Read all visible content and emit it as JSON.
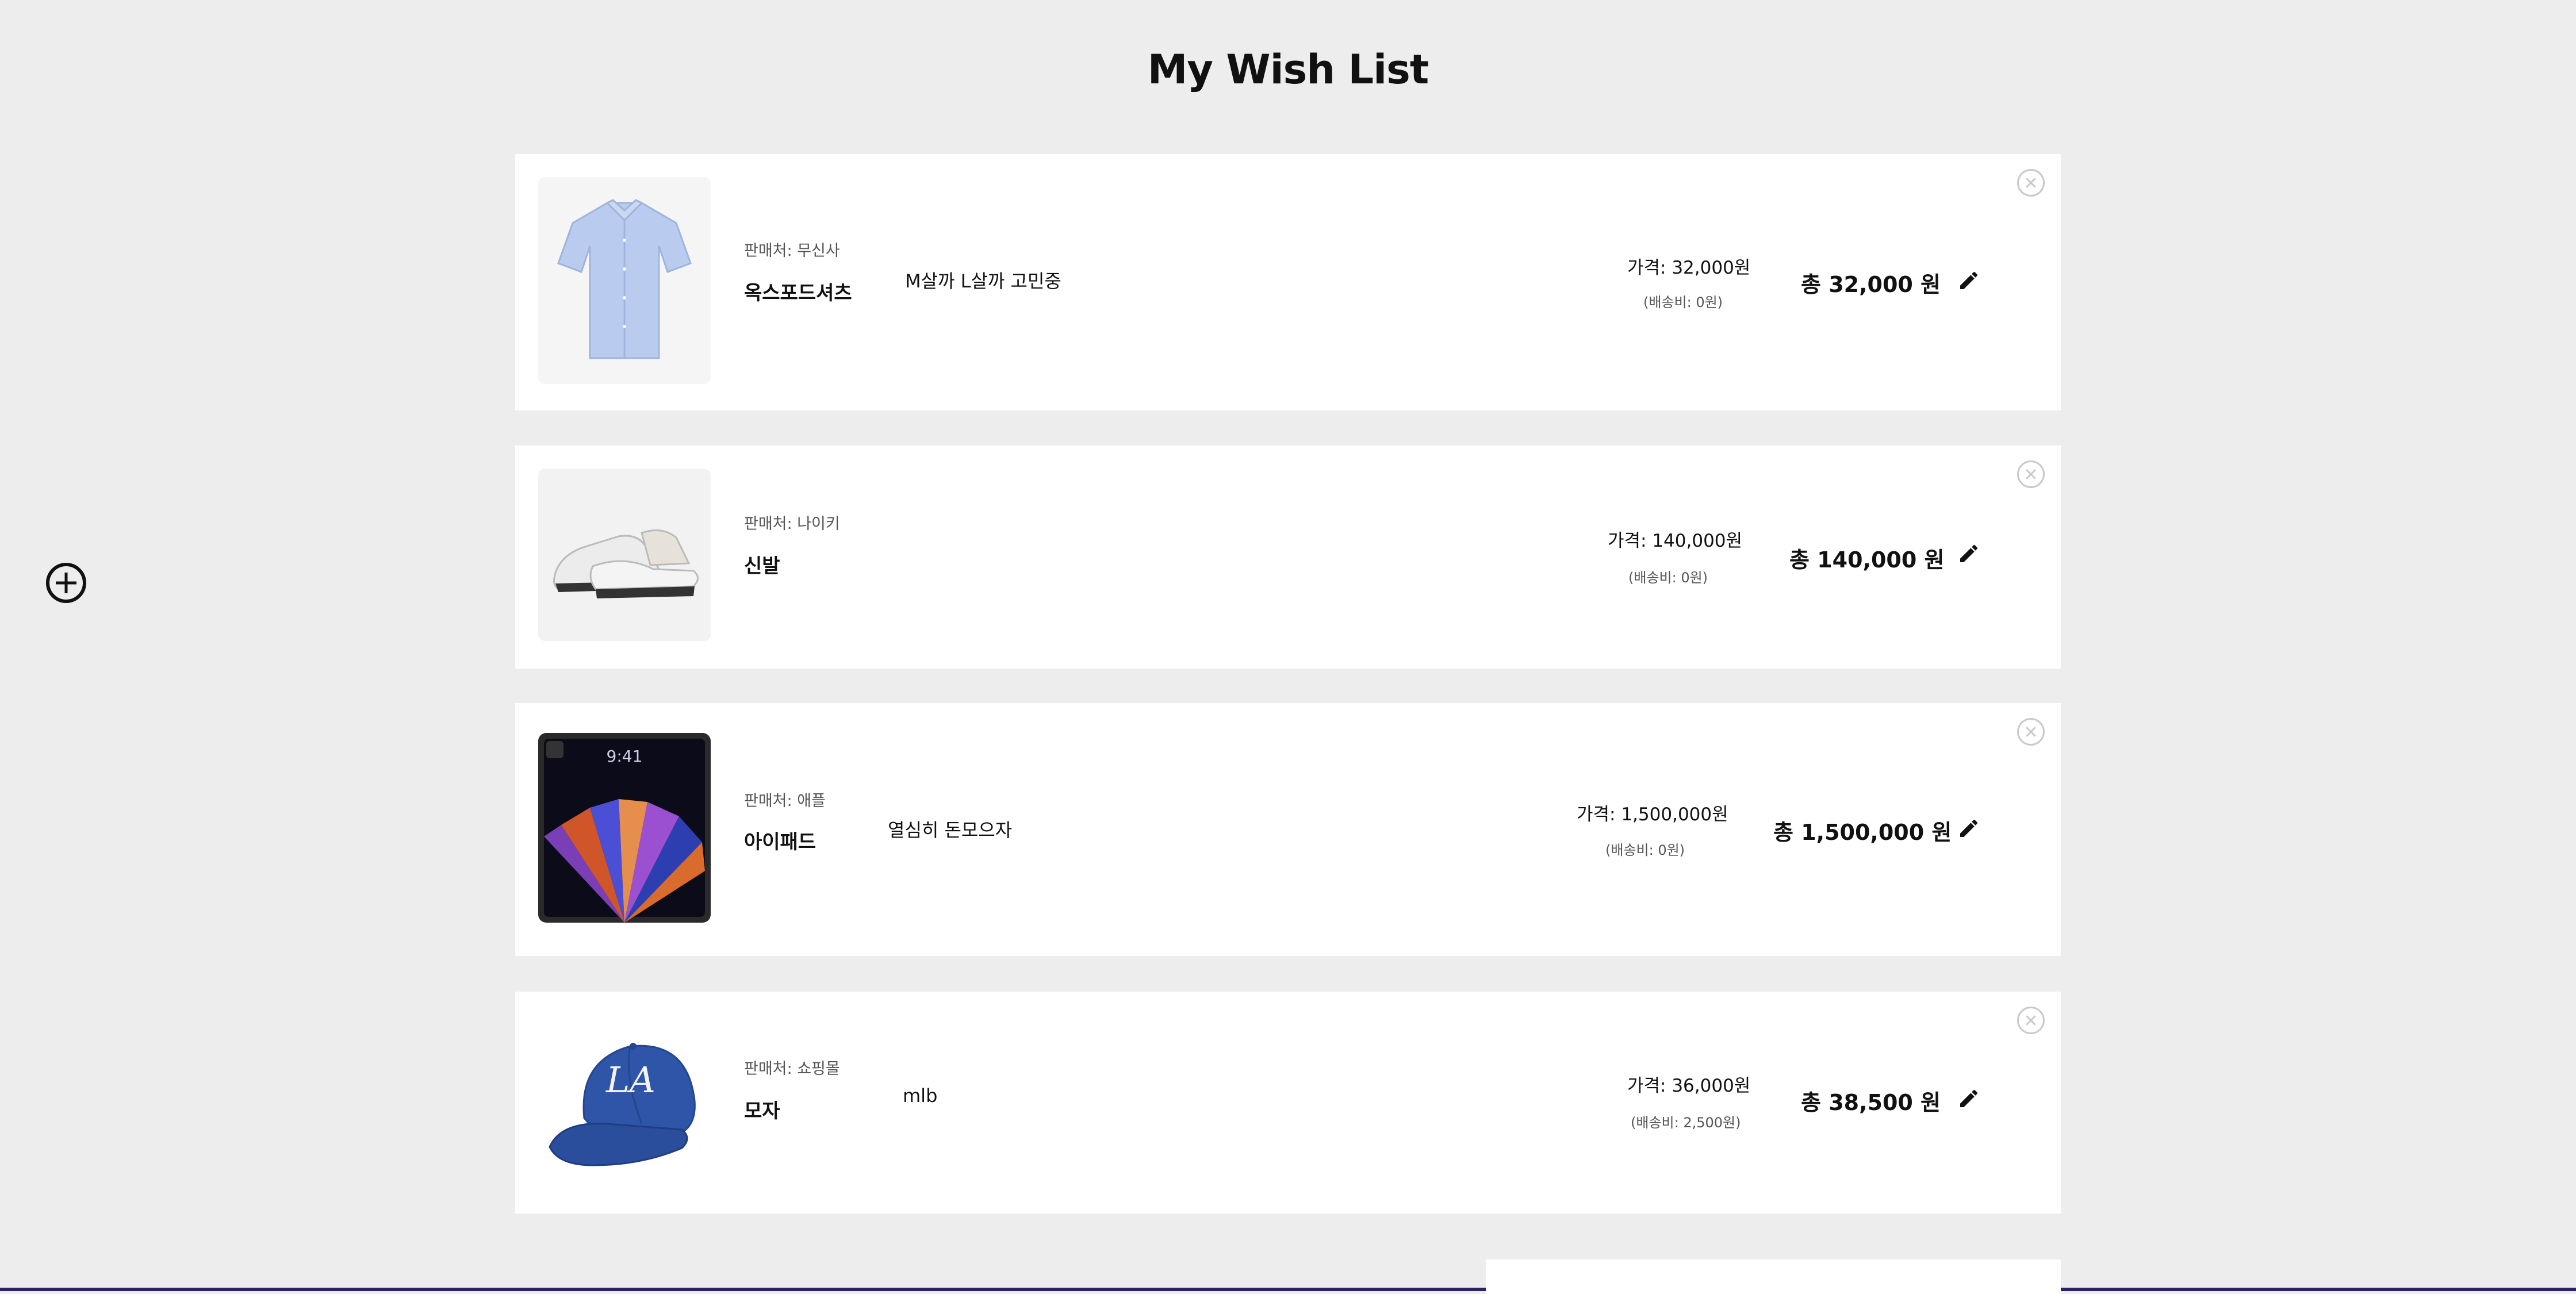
{
  "page": {
    "title": "My Wish List"
  },
  "icons": {
    "add": "plus-circle-icon",
    "edit": "pencil-icon",
    "remove": "close-circle-icon"
  },
  "colors": {
    "background": "#ededed",
    "card": "#ffffff",
    "text": "#111111",
    "muted": "#555555",
    "remove": "#c9c9c9"
  },
  "items": [
    {
      "image": "blue oxford shirt",
      "store": "판매처: 무신사",
      "name": "옥스포드셔츠",
      "memo": "M살까 L살까 고민중",
      "price": "가격: 32,000원",
      "shipping": "(배송비: 0원)",
      "total": "총 32,000 원"
    },
    {
      "image": "white sneakers",
      "store": "판매처: 나이키",
      "name": "신발",
      "memo": "",
      "price": "가격: 140,000원",
      "shipping": "(배송비: 0원)",
      "total": "총 140,000 원"
    },
    {
      "image": "ipad",
      "image_text": "9:41",
      "store": "판매처: 애플",
      "name": "아이패드",
      "memo": "열심히 돈모으자",
      "price": "가격: 1,500,000원",
      "shipping": "(배송비: 0원)",
      "total": "총 1,500,000 원"
    },
    {
      "image": "blue LA cap",
      "image_text": "LA",
      "store": "판매처: 쇼핑몰",
      "name": "모자",
      "memo": "mlb",
      "price": "가격: 36,000원",
      "shipping": "(배송비: 2,500원)",
      "total": "총 38,500 원"
    }
  ]
}
